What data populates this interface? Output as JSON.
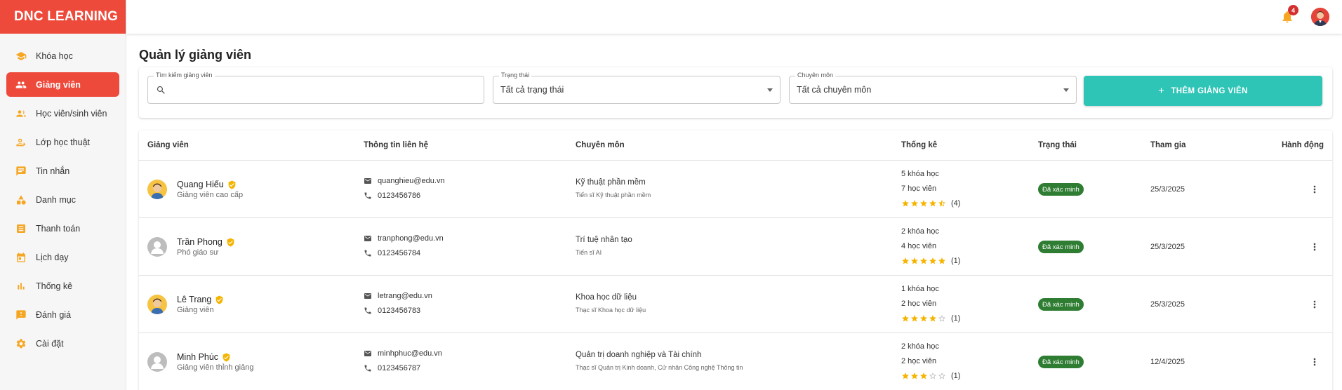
{
  "brand": "DNC LEARNING",
  "sidebar": {
    "items": [
      {
        "label": "Khóa học",
        "icon": "graduation-cap-icon",
        "active": false
      },
      {
        "label": "Giảng viên",
        "icon": "people-icon",
        "active": true
      },
      {
        "label": "Học viên/sinh viên",
        "icon": "group-icon",
        "active": false
      },
      {
        "label": "Lớp học thuật",
        "icon": "class-icon",
        "active": false
      },
      {
        "label": "Tin nhắn",
        "icon": "message-icon",
        "active": false
      },
      {
        "label": "Danh mục",
        "icon": "category-icon",
        "active": false
      },
      {
        "label": "Thanh toán",
        "icon": "receipt-icon",
        "active": false
      },
      {
        "label": "Lịch dạy",
        "icon": "calendar-icon",
        "active": false
      },
      {
        "label": "Thống kê",
        "icon": "bar-chart-icon",
        "active": false
      },
      {
        "label": "Đánh giá",
        "icon": "feedback-icon",
        "active": false
      },
      {
        "label": "Cài đặt",
        "icon": "gear-icon",
        "active": false
      }
    ]
  },
  "topbar": {
    "notification_count": "4"
  },
  "page": {
    "title": "Quản lý giảng viên"
  },
  "filters": {
    "search_label": "Tìm kiếm giảng viên",
    "search_value": "",
    "status_label": "Trạng thái",
    "status_value": "Tất cả trạng thái",
    "specialty_label": "Chuyên môn",
    "specialty_value": "Tất cả chuyên môn",
    "add_button": "THÊM GIẢNG VIÊN"
  },
  "table": {
    "headers": [
      "Giảng viên",
      "Thông tin liên hệ",
      "Chuyên môn",
      "Thống kê",
      "Trạng thái",
      "Tham gia",
      "Hành động"
    ],
    "rows": [
      {
        "name": "Quang Hiếu",
        "title": "Giảng viên cao cấp",
        "avatar": "yellow-photo",
        "email": "quanghieu@edu.vn",
        "phone": "0123456786",
        "specialty": "Kỹ thuật phần mềm",
        "degree": "Tiến sĩ Kỹ thuật phần mềm",
        "courses": "5 khóa học",
        "students": "7 học viên",
        "rating": 4.5,
        "reviews": "(4)",
        "status": "Đã xác minh",
        "joined": "25/3/2025"
      },
      {
        "name": "Trần Phong",
        "title": "Phó giáo sư",
        "avatar": "placeholder",
        "email": "tranphong@edu.vn",
        "phone": "0123456784",
        "specialty": "Trí tuệ nhân tạo",
        "degree": "Tiến sĩ AI",
        "courses": "2 khóa học",
        "students": "4 học viên",
        "rating": 5,
        "reviews": "(1)",
        "status": "Đã xác minh",
        "joined": "25/3/2025"
      },
      {
        "name": "Lê Trang",
        "title": "Giảng viên",
        "avatar": "yellow-photo",
        "email": "letrang@edu.vn",
        "phone": "0123456783",
        "specialty": "Khoa học dữ liệu",
        "degree": "Thạc sĩ Khoa học dữ liệu",
        "courses": "1 khóa học",
        "students": "2 học viên",
        "rating": 4,
        "reviews": "(1)",
        "status": "Đã xác minh",
        "joined": "25/3/2025"
      },
      {
        "name": "Minh Phúc",
        "title": "Giảng viên thỉnh giảng",
        "avatar": "placeholder",
        "email": "minhphuc@edu.vn",
        "phone": "0123456787",
        "specialty": "Quản trị doanh nghiệp và Tài chính",
        "degree": "Thạc sĩ Quản trị Kinh doanh, Cử nhân Công nghệ Thông tin",
        "courses": "2 khóa học",
        "students": "2 học viên",
        "rating": 3,
        "reviews": "(1)",
        "status": "Đã xác minh",
        "joined": "12/4/2025"
      }
    ]
  },
  "colors": {
    "brand": "#ee4a3c",
    "accent": "#2ec4b6",
    "icon": "#f5a623",
    "verified": "#f5b400",
    "status": "#2e7d32",
    "star": "#f5b400"
  }
}
